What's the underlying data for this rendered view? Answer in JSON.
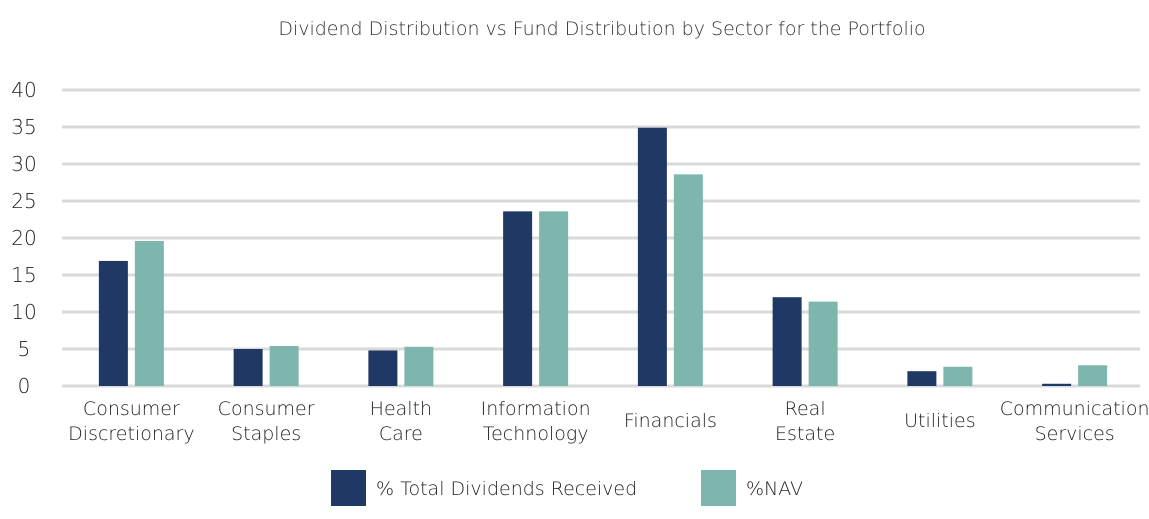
{
  "chart_data": {
    "type": "bar",
    "title": "Dividend Distribution vs Fund Distribution by Sector for the Portfolio",
    "xlabel": "",
    "ylabel": "",
    "ylim": [
      0,
      40
    ],
    "yticks": [
      "0",
      "5",
      "10",
      "15",
      "20",
      "25",
      "30",
      "35",
      "40"
    ],
    "grid": true,
    "legend_position": "bottom",
    "categories": [
      [
        "Consumer",
        "Discretionary"
      ],
      [
        "Consumer",
        "Staples"
      ],
      [
        "Health",
        "Care"
      ],
      [
        "Information",
        "Technology"
      ],
      [
        "Financials"
      ],
      [
        "Real",
        "Estate"
      ],
      [
        "Utilities"
      ],
      [
        "Communication",
        "Services"
      ]
    ],
    "series": [
      {
        "name": "% Total Dividends Received",
        "color": "#203864",
        "values": [
          16.9,
          5.0,
          4.8,
          23.6,
          34.9,
          12.0,
          2.0,
          0.3
        ]
      },
      {
        "name": "%NAV",
        "color": "#7CB6AC",
        "values": [
          19.6,
          5.4,
          5.3,
          23.6,
          28.6,
          11.4,
          2.6,
          2.8
        ]
      }
    ],
    "gridline_color": "#D9D9D9"
  }
}
